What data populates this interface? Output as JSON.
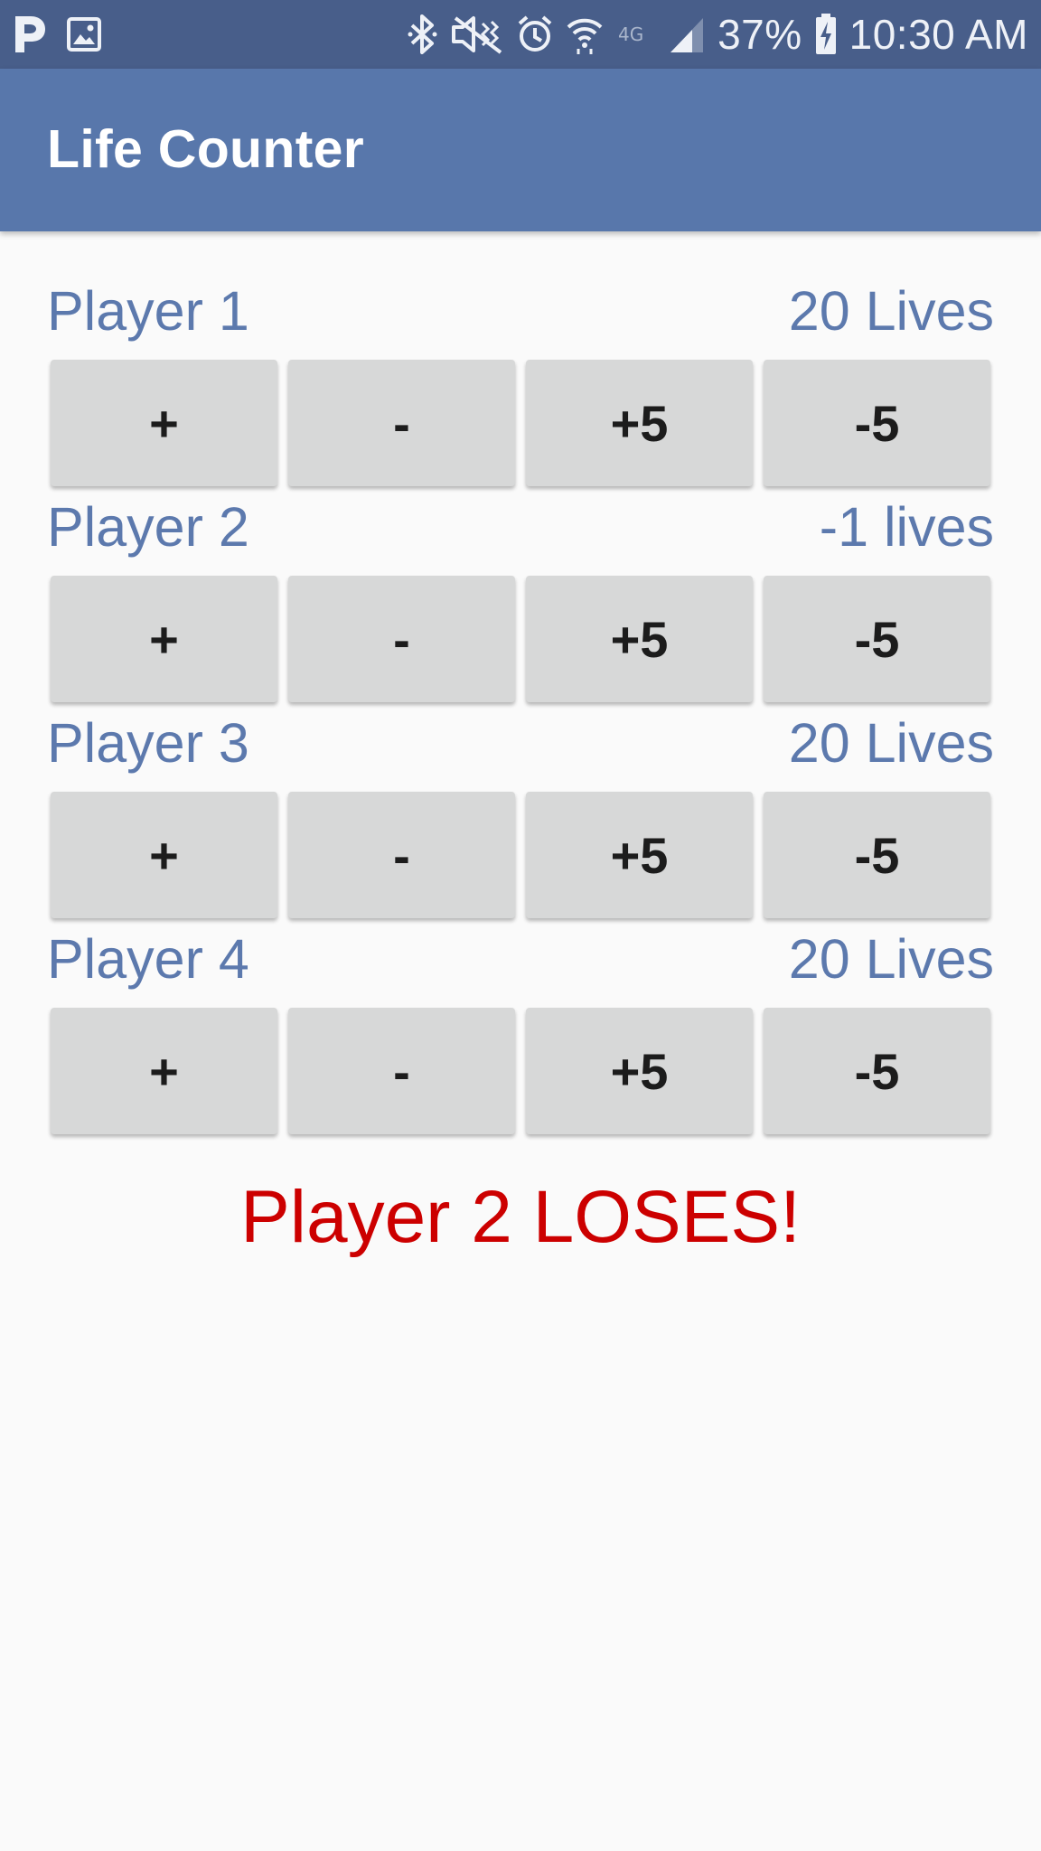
{
  "status_bar": {
    "left_icons": [
      "pandora-icon",
      "image-icon"
    ],
    "right_icons": [
      "bluetooth-icon",
      "mute-vibrate-icon",
      "alarm-icon",
      "wifi-icon",
      "lte-icon",
      "signal-icon"
    ],
    "lte_label": "4G",
    "battery": "37%",
    "time": "10:30 AM"
  },
  "app_bar": {
    "title": "Life Counter"
  },
  "players": [
    {
      "name": "Player 1",
      "lives": "20 Lives",
      "buttons": [
        "+",
        "-",
        "+5",
        "-5"
      ]
    },
    {
      "name": "Player 2",
      "lives": "-1 lives",
      "buttons": [
        "+",
        "-",
        "+5",
        "-5"
      ]
    },
    {
      "name": "Player 3",
      "lives": "20 Lives",
      "buttons": [
        "+",
        "-",
        "+5",
        "-5"
      ]
    },
    {
      "name": "Player 4",
      "lives": "20 Lives",
      "buttons": [
        "+",
        "-",
        "+5",
        "-5"
      ]
    }
  ],
  "result": "Player 2 LOSES!",
  "colors": {
    "status_bar": "#485e8a",
    "app_bar": "#5877ab",
    "player_text": "#5c79ad",
    "button_bg": "#d7d8d8",
    "lose_text": "#cc0000"
  }
}
